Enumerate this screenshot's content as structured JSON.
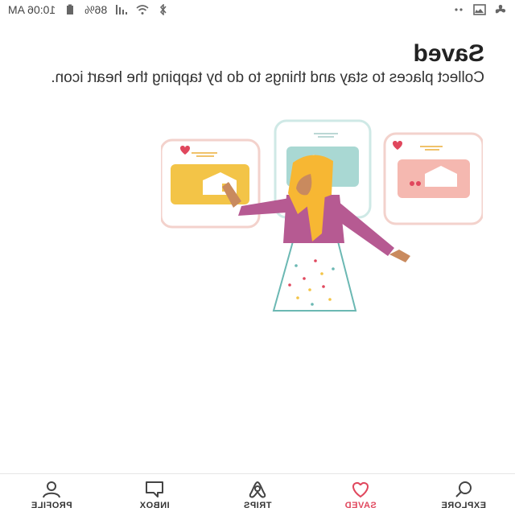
{
  "status_bar": {
    "time": "10:06 AM",
    "battery": "86%",
    "icons_left": [
      "fan-icon",
      "image-icon",
      "dots-icon"
    ],
    "icons_right": [
      "bluetooth-icon",
      "wifi-icon",
      "signal-icon",
      "battery-icon"
    ]
  },
  "header": {
    "title": "Saved",
    "subtitle": "Collect places to stay and things to do by tapping the heart icon."
  },
  "colors": {
    "accent": "#e0475d",
    "card_peach": "#f5b8b0",
    "card_teal": "#a9d8d3",
    "card_yellow": "#f3c447",
    "dress": "#b65a92",
    "hijab": "#f7b733"
  },
  "nav": {
    "items": [
      {
        "key": "explore",
        "label": "EXPLORE",
        "icon": "search-icon",
        "active": false
      },
      {
        "key": "saved",
        "label": "SAVED",
        "icon": "heart-icon",
        "active": true
      },
      {
        "key": "trips",
        "label": "TRIPS",
        "icon": "airbnb-logo-icon",
        "active": false
      },
      {
        "key": "inbox",
        "label": "INBOX",
        "icon": "chat-bubble-icon",
        "active": false
      },
      {
        "key": "profile",
        "label": "PROFILE",
        "icon": "person-icon",
        "active": false
      }
    ]
  }
}
